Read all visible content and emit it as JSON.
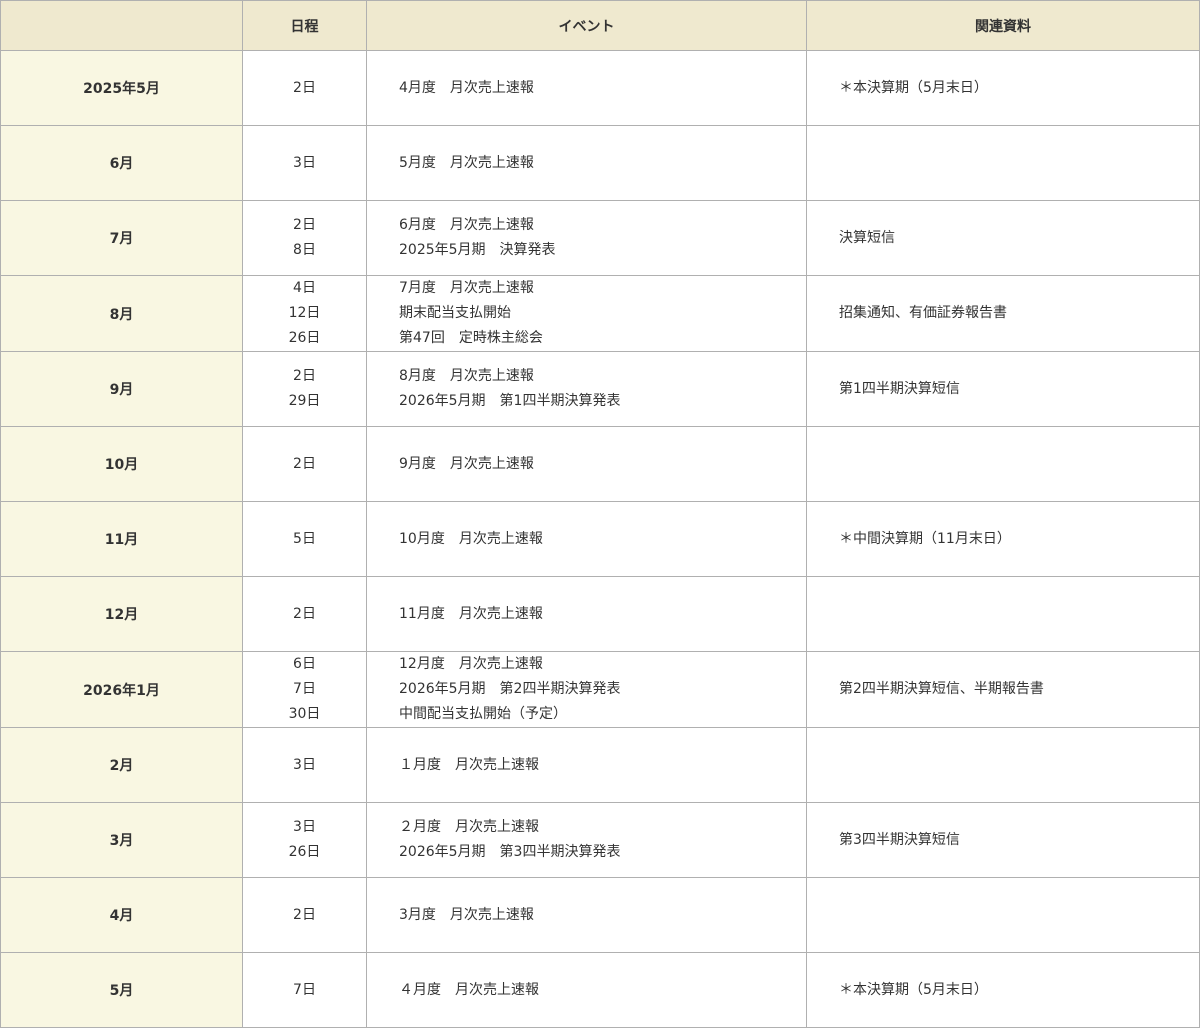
{
  "table": {
    "headers": {
      "month": "",
      "days": "日程",
      "events": "イベント",
      "docs": "関連資料"
    },
    "rows": [
      {
        "month": "2025年5月",
        "days": [
          "2日"
        ],
        "events": [
          "4月度　月次売上速報"
        ],
        "docs": "＊本決算期（5月末日）"
      },
      {
        "month": "6月",
        "days": [
          "3日"
        ],
        "events": [
          "5月度　月次売上速報"
        ],
        "docs": ""
      },
      {
        "month": "7月",
        "days": [
          "2日",
          "8日"
        ],
        "events": [
          "6月度　月次売上速報",
          "2025年5月期　決算発表"
        ],
        "docs": "決算短信"
      },
      {
        "month": "8月",
        "days": [
          "4日",
          "12日",
          "26日"
        ],
        "events": [
          "7月度　月次売上速報",
          "期末配当支払開始",
          "第47回　定時株主総会"
        ],
        "docs": "招集通知、有価証券報告書"
      },
      {
        "month": "9月",
        "days": [
          "2日",
          "29日"
        ],
        "events": [
          "8月度　月次売上速報",
          "2026年5月期　第1四半期決算発表"
        ],
        "docs": "第1四半期決算短信"
      },
      {
        "month": "10月",
        "days": [
          "2日"
        ],
        "events": [
          "9月度　月次売上速報"
        ],
        "docs": ""
      },
      {
        "month": "11月",
        "days": [
          "5日"
        ],
        "events": [
          "10月度　月次売上速報"
        ],
        "docs": "＊中間決算期（11月末日）"
      },
      {
        "month": "12月",
        "days": [
          "2日"
        ],
        "events": [
          "11月度　月次売上速報"
        ],
        "docs": ""
      },
      {
        "month": "2026年1月",
        "days": [
          "6日",
          "7日",
          "30日"
        ],
        "events": [
          "12月度　月次売上速報",
          "2026年5月期　第2四半期決算発表",
          "中間配当支払開始（予定）"
        ],
        "docs": "第2四半期決算短信、半期報告書"
      },
      {
        "month": "2月",
        "days": [
          "3日"
        ],
        "events": [
          "１月度　月次売上速報"
        ],
        "docs": ""
      },
      {
        "month": "3月",
        "days": [
          "3日",
          "26日"
        ],
        "events": [
          "２月度　月次売上速報",
          "2026年5月期　第3四半期決算発表"
        ],
        "docs": "第3四半期決算短信"
      },
      {
        "month": "4月",
        "days": [
          "2日"
        ],
        "events": [
          "3月度　月次売上速報"
        ],
        "docs": ""
      },
      {
        "month": "5月",
        "days": [
          "7日"
        ],
        "events": [
          "４月度　月次売上速報"
        ],
        "docs": "＊本決算期（5月末日）"
      }
    ]
  }
}
